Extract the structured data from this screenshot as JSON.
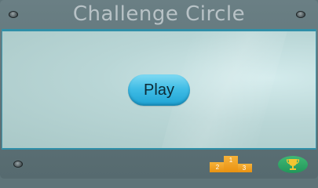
{
  "header": {
    "title": "Challenge Circle"
  },
  "main": {
    "play_label": "Play"
  },
  "footer": {
    "leaderboard": {
      "icon": "podium-icon",
      "places": [
        "2",
        "1",
        "3"
      ]
    },
    "achievements": {
      "icon": "trophy-icon"
    }
  },
  "colors": {
    "title_text": "#b8c2c6",
    "frame": "#5f7479",
    "panel_border": "#2f8fa8",
    "panel_bg": "#b9d6d6",
    "play_button": "#41bde6",
    "podium": "#f0a020",
    "trophy_bg": "#2fae68",
    "trophy": "#f2c531"
  }
}
